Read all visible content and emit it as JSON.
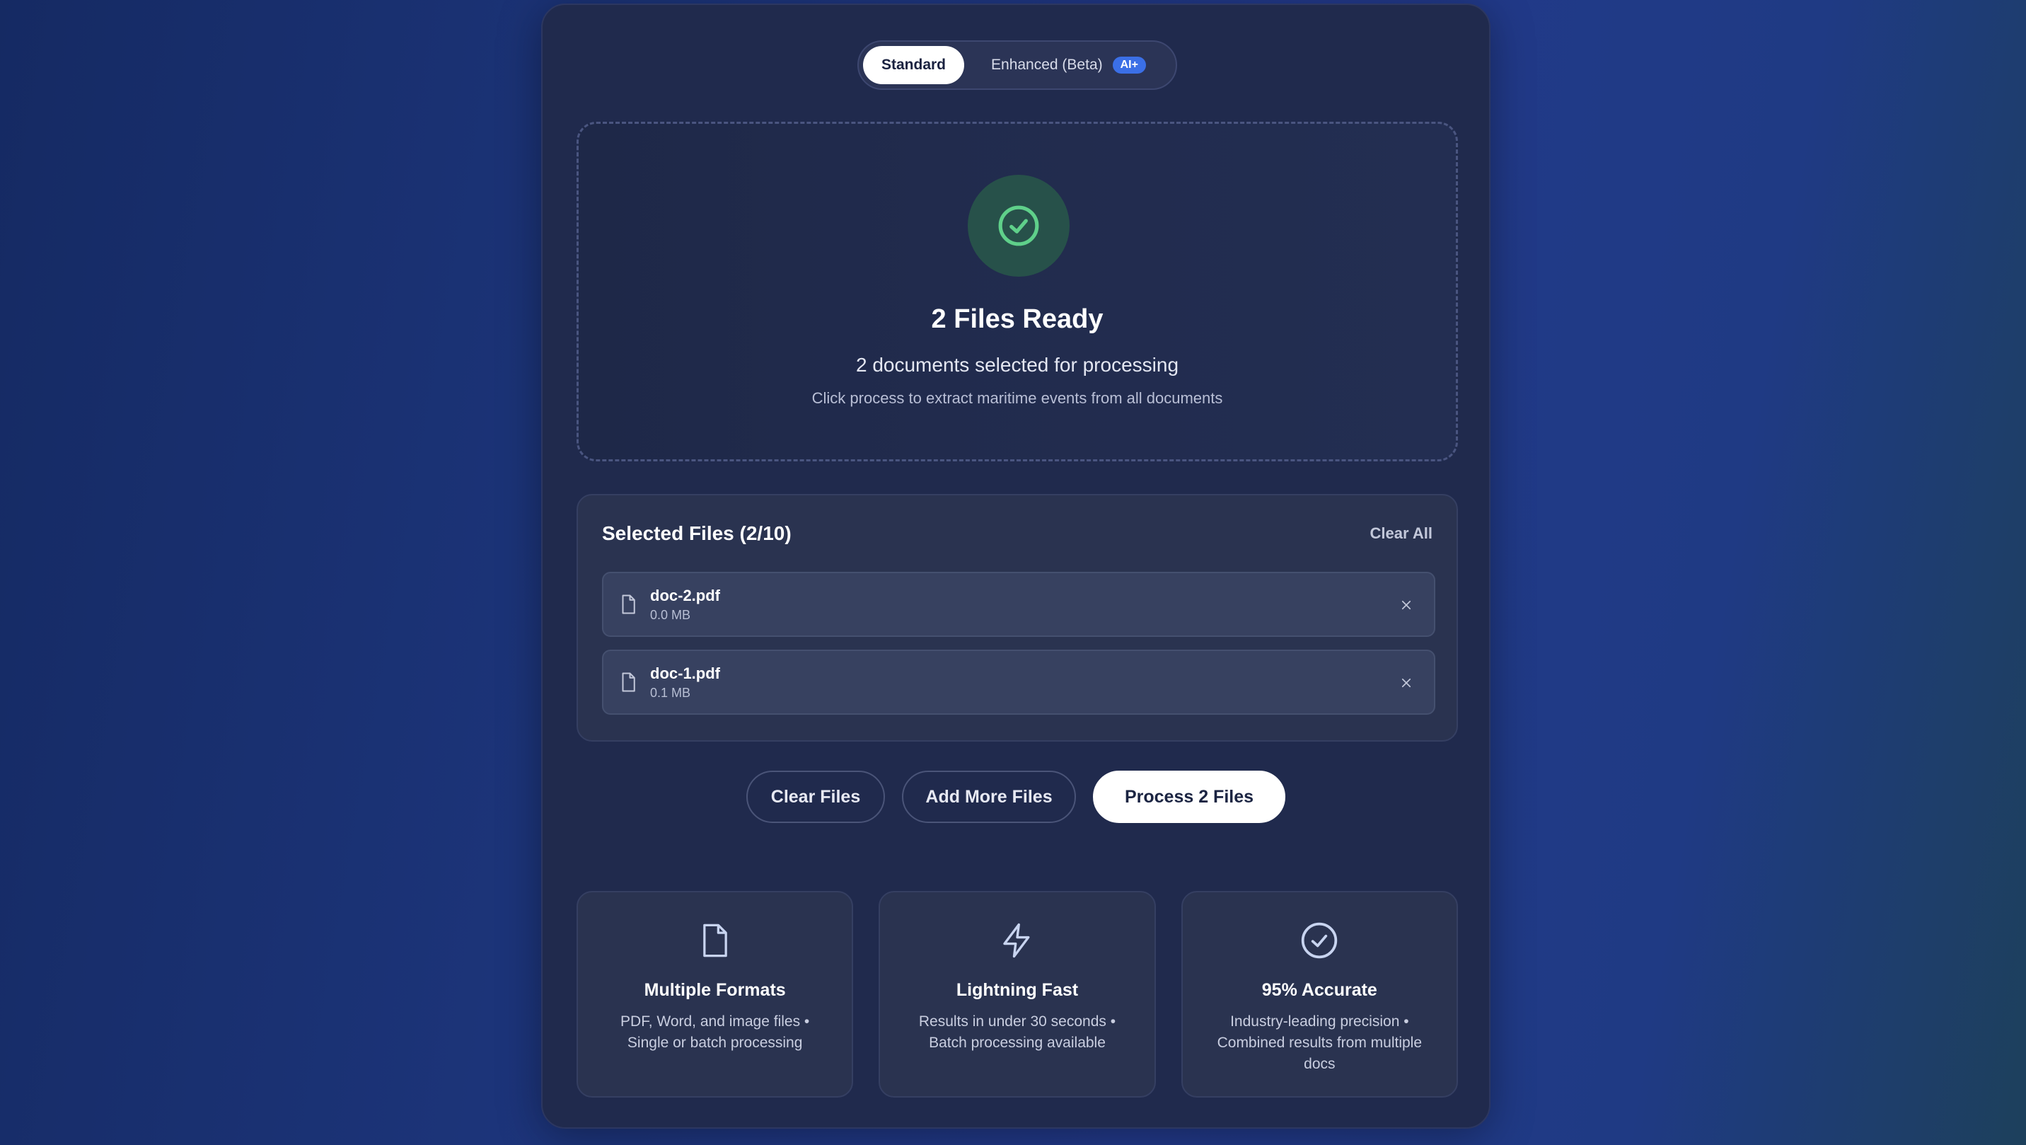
{
  "mode_toggle": {
    "standard_label": "Standard",
    "enhanced_label": "Enhanced (Beta)",
    "ai_badge": "AI+"
  },
  "dropzone": {
    "title": "2 Files Ready",
    "subtitle": "2 documents selected for processing",
    "hint": "Click process to extract maritime events from all documents",
    "status_icon": "check-circle-icon",
    "status_color": "#5fd08a"
  },
  "files": {
    "title": "Selected Files (2/10)",
    "clear_all_label": "Clear All",
    "items": [
      {
        "name": "doc-2.pdf",
        "size": "0.0 MB"
      },
      {
        "name": "doc-1.pdf",
        "size": "0.1 MB"
      }
    ]
  },
  "actions": {
    "clear_label": "Clear Files",
    "add_label": "Add More Files",
    "process_label": "Process 2 Files"
  },
  "features": [
    {
      "icon": "file-icon",
      "title": "Multiple Formats",
      "desc": "PDF, Word, and image files • Single or batch processing"
    },
    {
      "icon": "lightning-icon",
      "title": "Lightning Fast",
      "desc": "Results in under 30 seconds • Batch processing available"
    },
    {
      "icon": "check-circle-icon",
      "title": "95% Accurate",
      "desc": "Industry-leading precision • Combined results from multiple docs"
    }
  ],
  "colors": {
    "accent_blue": "#3b6fe6",
    "icon_light": "#c8d4f0"
  }
}
